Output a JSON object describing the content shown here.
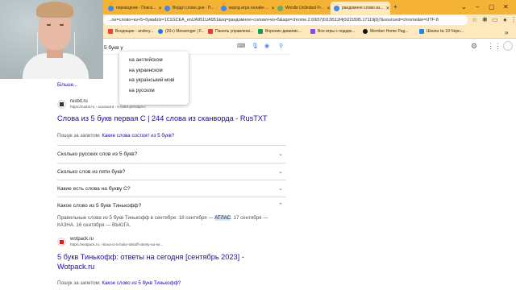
{
  "tabs": [
    {
      "label": "переводчик - Поиск...",
      "color": "#4285f4"
    },
    {
      "label": "Вордл слово дня - П...",
      "color": "#4285f4"
    },
    {
      "label": "ворлд игра онлайн ...",
      "color": "#4285f4"
    },
    {
      "label": "Wordle Unlimited Fr...",
      "color": "#6aaa64"
    },
    {
      "label": "рандомное слово из...",
      "color": "#4285f4"
    }
  ],
  "address_bar": {
    "url": "...ne=слово+из+5+букв&rlz=1C1GCEA_enUA951UA951&oq=рандомное+соловл+из+5&aqs=chrome.2.69i57j0i13i512l4j0i22i30l5.17119j0j7&sourceid=chrome&ie=UTF-8"
  },
  "bookmarks": [
    {
      "label": "Входящие - andrey...",
      "color": "#ea4335"
    },
    {
      "label": "(20+) Messenger | F...",
      "color": "#1877f2"
    },
    {
      "label": "Панель управлени...",
      "color": "#e53935"
    },
    {
      "label": "Воронин дивилис...",
      "color": "#0f9d58"
    },
    {
      "label": "Все игры с подарк...",
      "color": "#7c4dff"
    },
    {
      "label": "Member Home Pag...",
      "color": "#111111"
    },
    {
      "label": "Школа № 19 Черн...",
      "color": "#1e88e5"
    }
  ],
  "search": {
    "query": "5 букв у"
  },
  "suggestions": [
    "на английском",
    "на украинском",
    "на український мові",
    "на русском"
  ],
  "more_link": "Більше...",
  "result1": {
    "site_name": "rustxt.ru",
    "site_url": "https://rustxt.ru › scanword › 5-bukv-pervaya-c",
    "title": "Слова из 5 букв первая С | 244 слова из сканворда - RusTXT",
    "also_prefix": "Пошук за запитом:",
    "also_link": "Какие слова состоят из 5 букв?"
  },
  "faq": [
    {
      "question": "Сколько русских слов из 5 букв?",
      "chevron": "⌄"
    },
    {
      "question": "Сколько слов из пяти букв?",
      "chevron": "⌄"
    },
    {
      "question": "Какие есть слова на букву С?",
      "chevron": "⌄"
    },
    {
      "question": "Какое слово из 5 букв Тинькофф?",
      "chevron": "⌃"
    }
  ],
  "answer": {
    "before": "Правильные слова из 5 букв Тинькофф в сентябре: 18 сентября — ",
    "highlight": "АТЛАС",
    "after": ". 17 сентября — КАЗНА. 16 сентября — ВЬЮГА."
  },
  "result2": {
    "site_name": "wotpack.ru",
    "site_url": "https://wotpack.ru › slova-iz-5-bukv-tinkoff-otvety-na-se...",
    "title": "5 букв Тинькофф: ответы на сегодня [сентябрь 2023] - Wotpack.ru",
    "also_prefix": "Пошук за запитом:",
    "also_link": "Какое слово из 5 букв Тинькофф?"
  }
}
